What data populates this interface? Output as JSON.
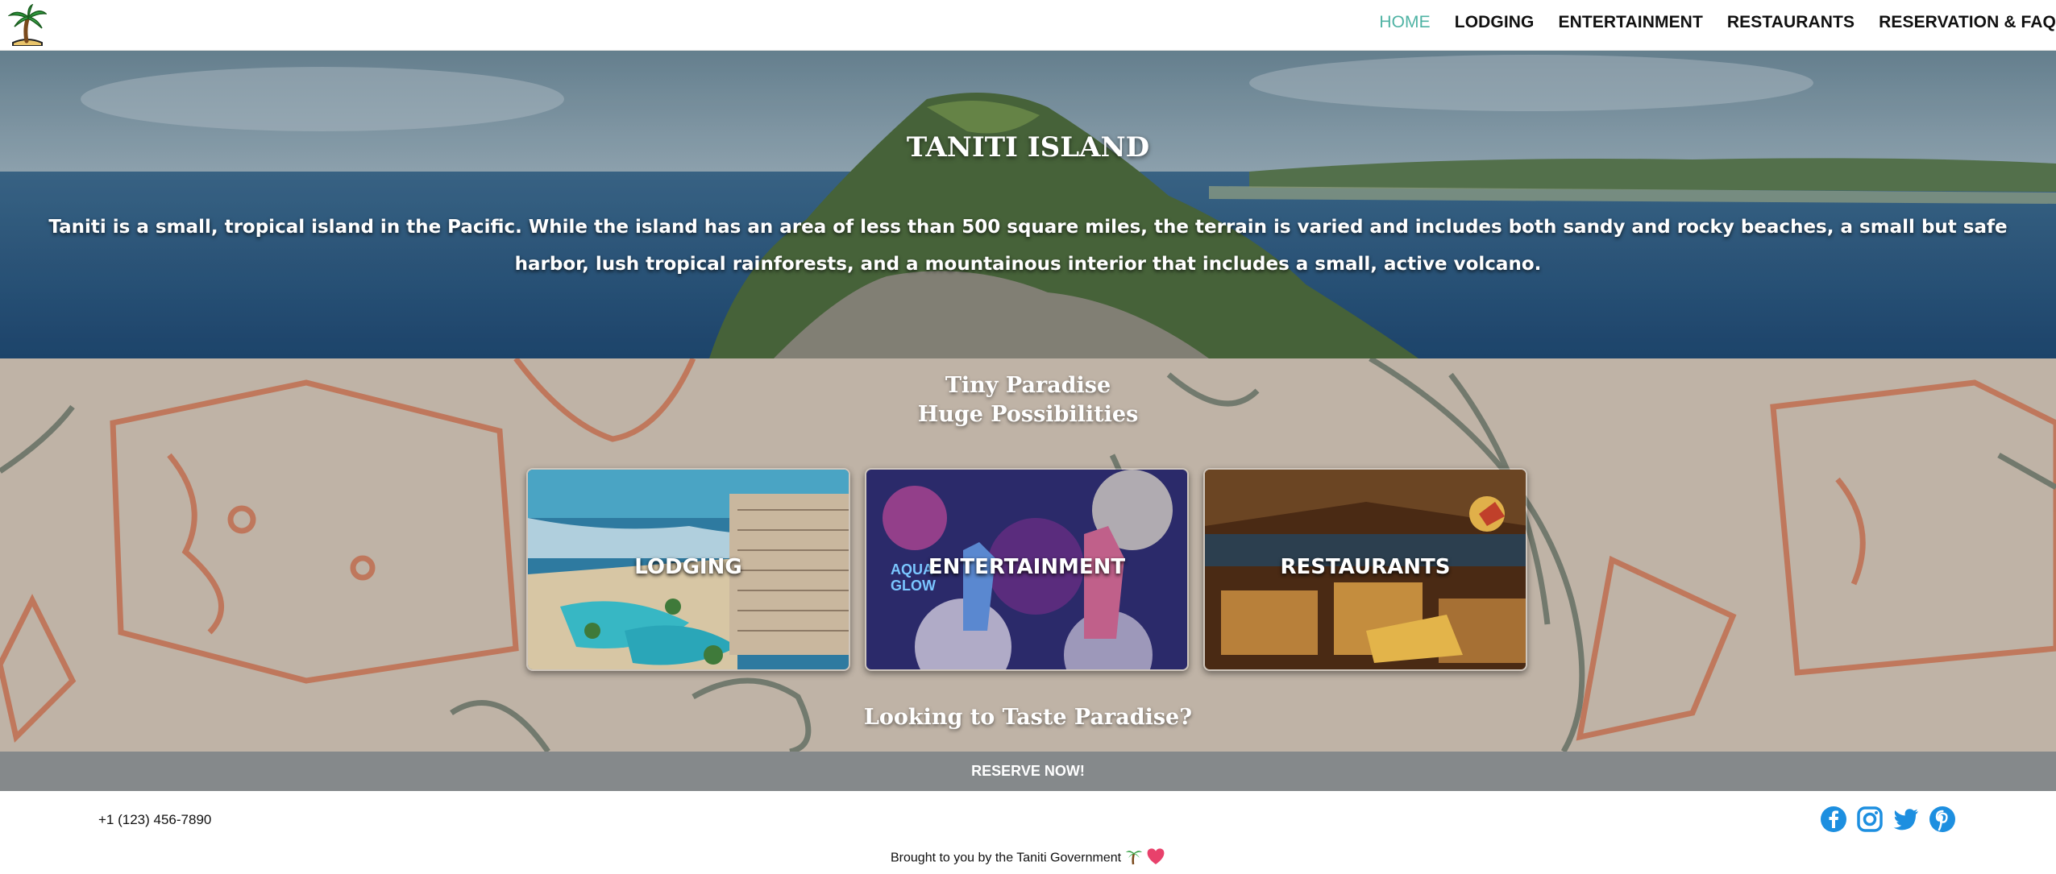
{
  "nav": {
    "logo": "palm-tree-logo",
    "links": [
      {
        "label": "HOME",
        "active": true
      },
      {
        "label": "LODGING",
        "active": false
      },
      {
        "label": "ENTERTAINMENT",
        "active": false
      },
      {
        "label": "RESTAURANTS",
        "active": false
      },
      {
        "label": "RESERVATION & FAQ",
        "active": false
      }
    ],
    "accent_color": "#4fb3a4"
  },
  "hero": {
    "title": "TANITI ISLAND",
    "description": "Taniti is a small, tropical island in the Pacific. While the island has an area of less than 500 square miles, the terrain is varied and includes both sandy and rocky beaches, a small but safe harbor, lush tropical rainforests, and a mountainous interior that includes a small, active volcano."
  },
  "middle": {
    "tagline_line1": "Tiny Paradise",
    "tagline_line2": "Huge Possibilities",
    "cards": [
      {
        "label": "LODGING",
        "image": "resort-hotel-pool"
      },
      {
        "label": "ENTERTAINMENT",
        "image": "foam-party"
      },
      {
        "label": "RESTAURANTS",
        "image": "tiki-restaurant"
      }
    ],
    "cta_heading": "Looking to Taste Paradise?"
  },
  "reserve": {
    "label": "RESERVE NOW!",
    "bar_color": "#85898b"
  },
  "footer": {
    "phone": "+1 (123) 456-7890",
    "credit": "Brought to you by the Taniti Government",
    "social_icons": [
      "facebook-icon",
      "instagram-icon",
      "twitter-icon",
      "pinterest-icon"
    ],
    "social_color": "#1d8fe0"
  }
}
